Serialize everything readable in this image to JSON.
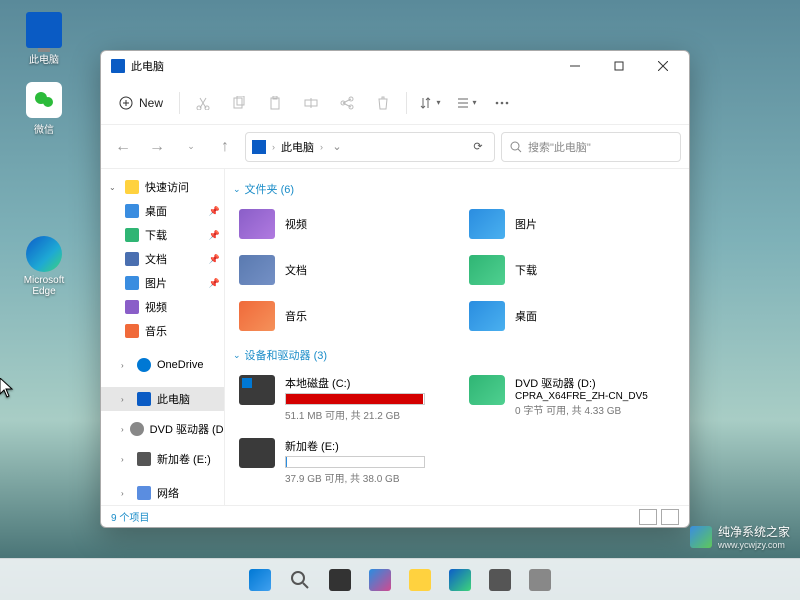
{
  "desktop": {
    "icons": [
      {
        "label": "此电脑",
        "name": "desktop-icon-this-pc"
      },
      {
        "label": "微信",
        "name": "desktop-icon-wechat"
      },
      {
        "label": "Microsoft Edge",
        "name": "desktop-icon-edge"
      }
    ]
  },
  "window": {
    "title": "此电脑",
    "new_label": "New",
    "breadcrumb": {
      "label": "此电脑",
      "sep": "›"
    },
    "search_placeholder": "搜索\"此电脑\"",
    "sidebar": {
      "quick": "快速访问",
      "desktop": "桌面",
      "downloads": "下载",
      "documents": "文档",
      "pictures": "图片",
      "videos": "视频",
      "music": "音乐",
      "onedrive": "OneDrive",
      "thispc": "此电脑",
      "dvd": "DVD 驱动器 (D:)",
      "vol_e": "新加卷 (E:)",
      "network": "网络"
    },
    "sections": {
      "folders": {
        "label": "文件夹 (6)",
        "items": [
          {
            "name": "视频",
            "icon": "fic-vid",
            "id": "videos"
          },
          {
            "name": "图片",
            "icon": "fic-pic",
            "id": "pictures"
          },
          {
            "name": "文档",
            "icon": "fic-doc",
            "id": "documents"
          },
          {
            "name": "下载",
            "icon": "fic-dl",
            "id": "downloads"
          },
          {
            "name": "音乐",
            "icon": "fic-music",
            "id": "music"
          },
          {
            "name": "桌面",
            "icon": "fic-desk",
            "id": "desktop"
          }
        ]
      },
      "drives": {
        "label": "设备和驱动器 (3)",
        "items": [
          {
            "name": "本地磁盘 (C:)",
            "sub": "51.1 MB 可用, 共 21.2 GB",
            "fill_pct": 99,
            "fill_color": "#d40000",
            "win": true,
            "id": "drive-c"
          },
          {
            "name": "DVD 驱动器 (D:)",
            "line2": "CPRA_X64FRE_ZH-CN_DV5",
            "sub": "0 字节 可用, 共 4.33 GB",
            "dvd": true,
            "id": "drive-d"
          },
          {
            "name": "新加卷 (E:)",
            "sub": "37.9 GB 可用, 共 38.0 GB",
            "fill_pct": 1,
            "fill_color": "#2a8de0",
            "id": "drive-e"
          }
        ]
      }
    },
    "status": "9 个项目"
  },
  "watermark": {
    "title": "纯净系统之家",
    "url": "www.ycwjzy.com"
  }
}
